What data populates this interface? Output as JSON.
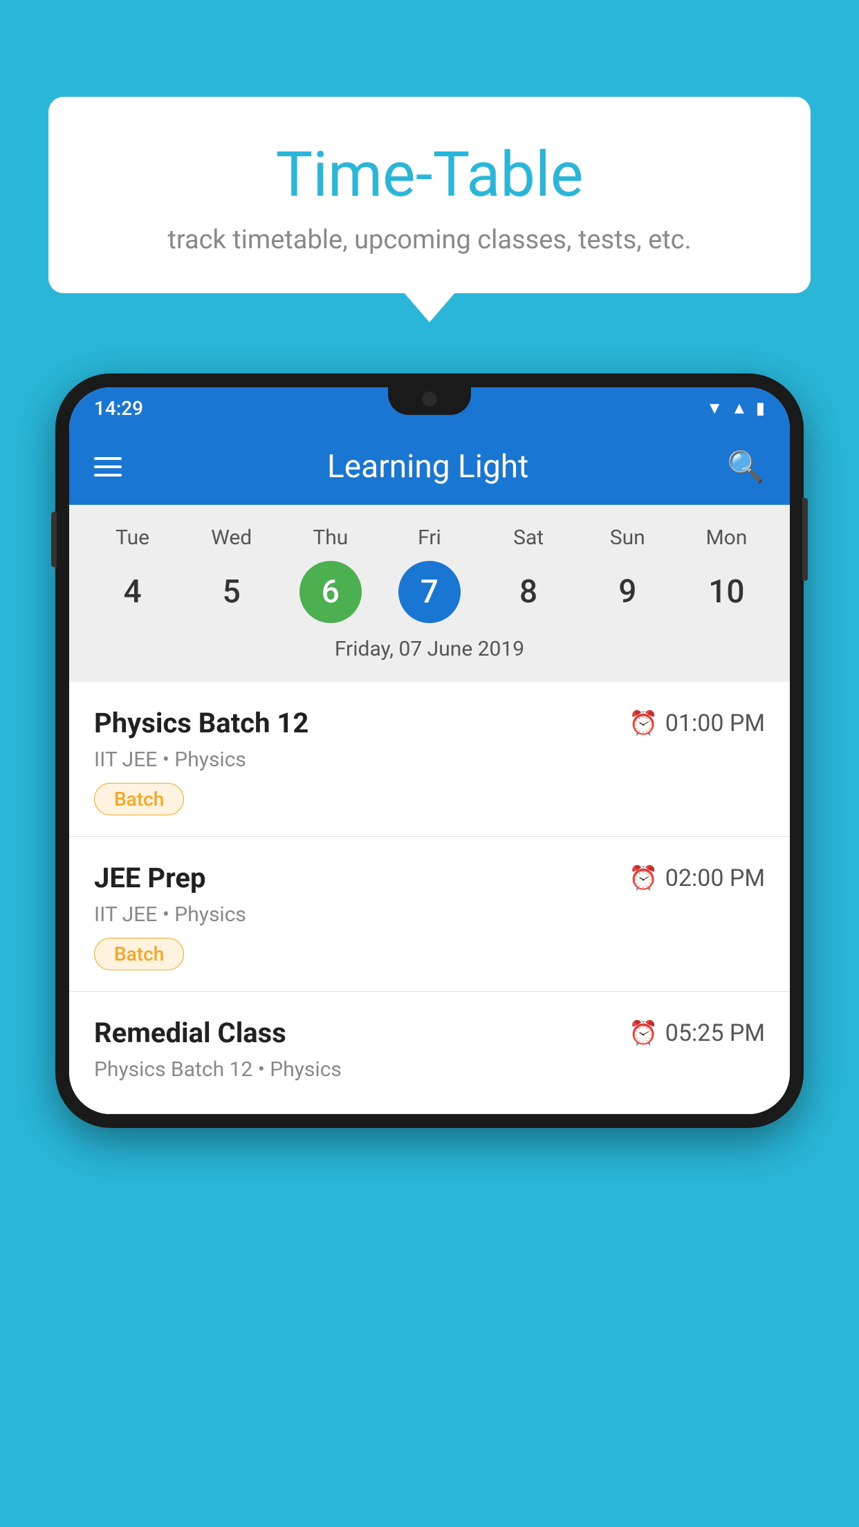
{
  "background_color": "#29b6d8",
  "speech_bubble": {
    "title": "Time-Table",
    "subtitle": "track timetable, upcoming classes, tests, etc."
  },
  "phone": {
    "status_bar": {
      "time": "14:29",
      "icons": [
        "wifi",
        "signal",
        "battery"
      ]
    },
    "app_bar": {
      "title": "Learning Light"
    },
    "calendar": {
      "days": [
        {
          "label": "Tue",
          "number": "4",
          "state": "normal"
        },
        {
          "label": "Wed",
          "number": "5",
          "state": "normal"
        },
        {
          "label": "Thu",
          "number": "6",
          "state": "today"
        },
        {
          "label": "Fri",
          "number": "7",
          "state": "selected"
        },
        {
          "label": "Sat",
          "number": "8",
          "state": "normal"
        },
        {
          "label": "Sun",
          "number": "9",
          "state": "normal"
        },
        {
          "label": "Mon",
          "number": "10",
          "state": "normal"
        }
      ],
      "selected_date_label": "Friday, 07 June 2019"
    },
    "schedule": [
      {
        "title": "Physics Batch 12",
        "time": "01:00 PM",
        "subtitle": "IIT JEE • Physics",
        "badge": "Batch"
      },
      {
        "title": "JEE Prep",
        "time": "02:00 PM",
        "subtitle": "IIT JEE • Physics",
        "badge": "Batch"
      },
      {
        "title": "Remedial Class",
        "time": "05:25 PM",
        "subtitle": "Physics Batch 12 • Physics",
        "badge": null
      }
    ]
  }
}
